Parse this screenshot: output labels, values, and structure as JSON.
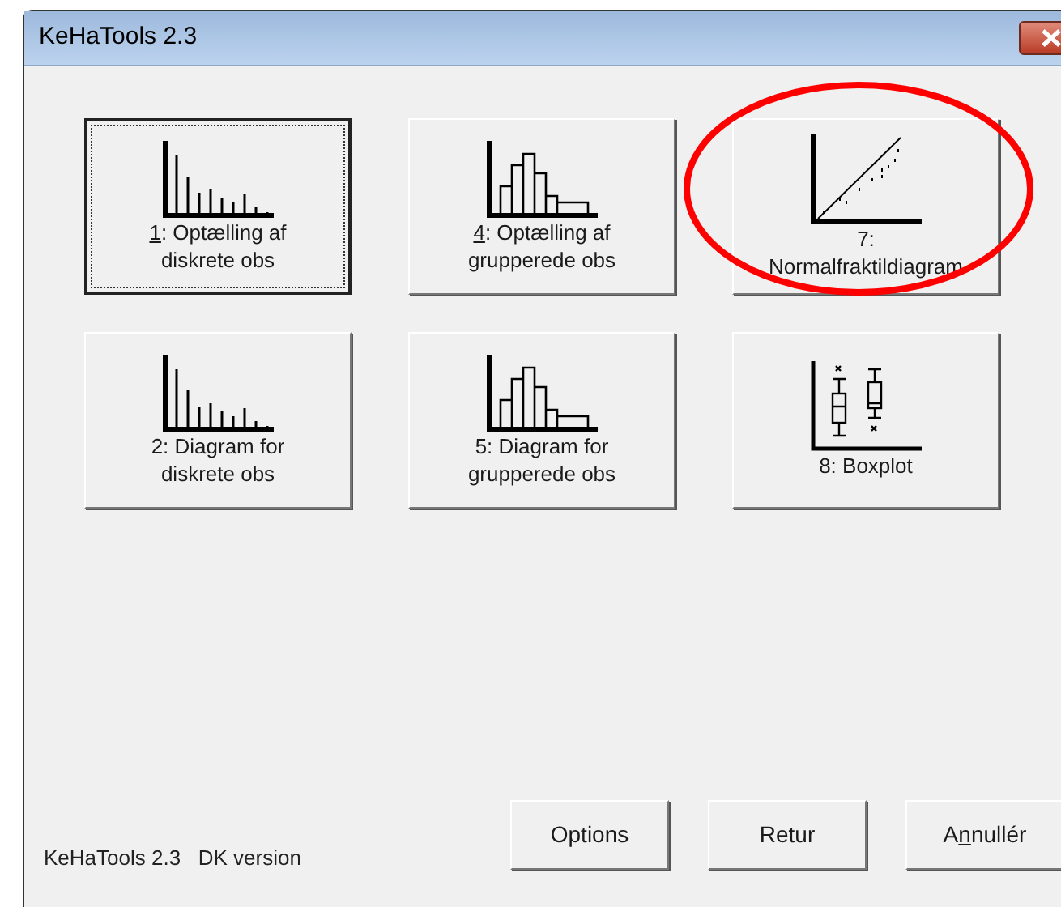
{
  "window": {
    "title": "KeHaTools 2.3"
  },
  "tools": [
    {
      "kind": "bars",
      "lines": [
        {
          "key": "1",
          "post": ": Optælling af"
        },
        {
          "pre": "diskrete obs"
        }
      ],
      "focused": true,
      "circled": false
    },
    {
      "kind": "histogram",
      "lines": [
        {
          "key": "4",
          "post": ": Optælling af"
        },
        {
          "pre": "grupperede obs"
        }
      ],
      "focused": false,
      "circled": false
    },
    {
      "kind": "qq",
      "lines": [
        {
          "pre": "7:"
        },
        {
          "pre": "Normalfraktildiagram"
        }
      ],
      "focused": false,
      "circled": true
    },
    {
      "kind": "bars",
      "lines": [
        {
          "pre": "2: Diagram for"
        },
        {
          "pre": "diskrete obs"
        }
      ],
      "focused": false,
      "circled": false
    },
    {
      "kind": "histogram",
      "lines": [
        {
          "pre": "5: Diagram for"
        },
        {
          "pre": "grupperede obs"
        }
      ],
      "focused": false,
      "circled": false
    },
    {
      "kind": "boxplot",
      "lines": [
        {
          "pre": "8: Boxplot"
        }
      ],
      "focused": false,
      "circled": false
    }
  ],
  "footer_text": "KeHaTools 2.3   DK version",
  "buttons": [
    {
      "pre": "Options"
    },
    {
      "pre": "Retur"
    },
    {
      "pre": "A",
      "key": "n",
      "post": "nullér"
    }
  ]
}
